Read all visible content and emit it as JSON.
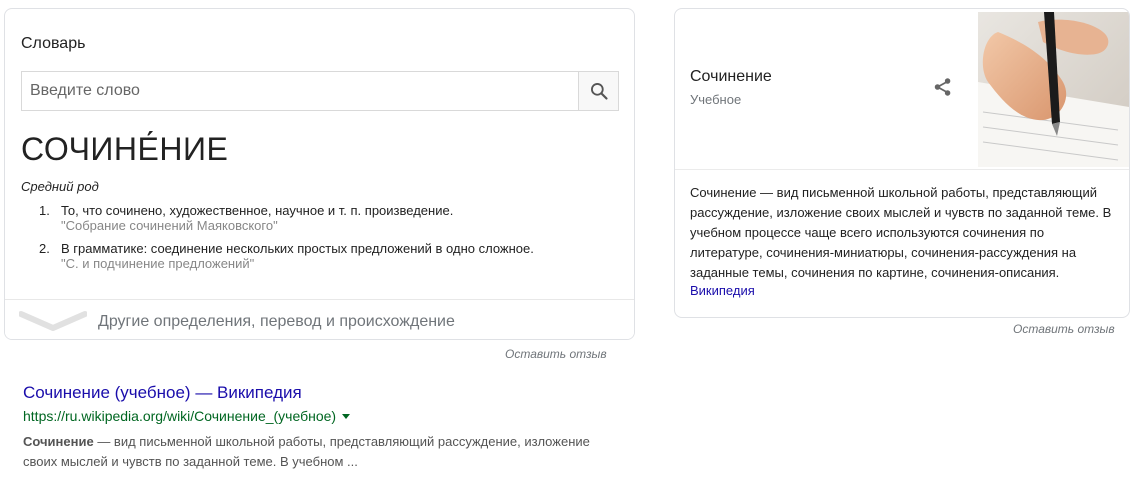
{
  "dictionary": {
    "title": "Словарь",
    "search_placeholder": "Введите слово",
    "headword": "СОЧИНЕ́НИЕ",
    "gender": "Средний род",
    "definitions": [
      {
        "num": "1.",
        "text": "То, что сочинено, художественное, научное и т. п. произведение.",
        "example": "\"Собрание сочинений Маяковского\""
      },
      {
        "num": "2.",
        "text": "В грамматике: соединение нескольких простых предложений в одно сложное.",
        "example": "\"С. и подчинение предложений\""
      }
    ],
    "more_label": "Другие определения, перевод и происхождение",
    "feedback": "Оставить отзыв"
  },
  "knowledge_panel": {
    "title": "Сочинение",
    "subtitle": "Учебное",
    "description": "Сочинение — вид письменной школьной работы, представляющий рассуждение, изложение своих мыслей и чувств по заданной теме. В учебном процессе чаще всего используются сочинения по литературе, сочинения-миниатюры, сочинения-рассуждения на заданные темы, сочинения по картине, сочинения-описания.",
    "source": "Википедия",
    "feedback": "Оставить отзыв"
  },
  "result": {
    "title": "Сочинение (учебное) — Википедия",
    "url": "https://ru.wikipedia.org/wiki/Сочинение_(учебное)",
    "snippet_bold": "Сочинение",
    "snippet_rest": " — вид письменной школьной работы, представляющий рассуждение, изложение своих мыслей и чувств по заданной теме. В учебном ..."
  },
  "colors": {
    "link": "#1a0dab",
    "url": "#006621",
    "muted": "#70757a"
  },
  "icons": {
    "search": "search-icon",
    "share": "share-icon",
    "chevron": "chevron-down-icon",
    "dropdown": "url-dropdown-arrow-icon"
  }
}
